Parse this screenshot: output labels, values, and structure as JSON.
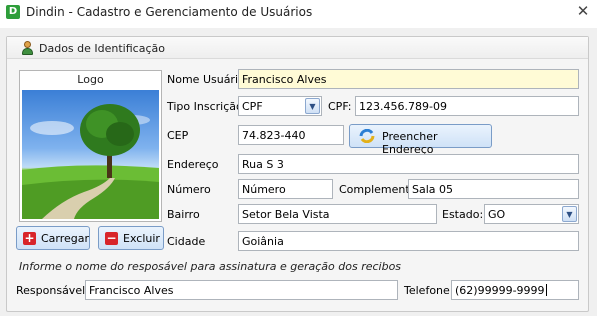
{
  "window": {
    "icon_letter": "D",
    "title": "Dindin - Cadastro e Gerenciamento de Usuários",
    "close_glyph": "✕"
  },
  "group": {
    "title": "Dados de Identificação"
  },
  "logo": {
    "label": "Logo",
    "load_button": "Carregar",
    "load_icon_glyph": "+",
    "delete_button": "Excluir",
    "delete_icon_glyph": "−"
  },
  "form": {
    "nome_label": "Nome Usuário",
    "nome_value": "Francisco Alves",
    "tipo_label": "Tipo Inscrição",
    "tipo_value": "CPF",
    "cpf_label": "CPF:",
    "cpf_value": "123.456.789-09",
    "cep_label": "CEP",
    "cep_value": "74.823-440",
    "fill_address_button": "Preencher Endereço",
    "endereco_label": "Endereço",
    "endereco_value": "Rua S 3",
    "numero_label": "Número",
    "numero_value": "Número",
    "complemento_label": "Complemento",
    "complemento_value": "Sala 05",
    "bairro_label": "Bairro",
    "bairro_value": "Setor Bela Vista",
    "estado_label": "Estado:",
    "estado_value": "GO",
    "cidade_label": "Cidade",
    "cidade_value": "Goiânia",
    "combo_arrow_glyph": "▼"
  },
  "responsible": {
    "instruction": "Informe o nome do resposável para assinatura e geração dos recibos",
    "responsavel_label": "Responsável:",
    "responsavel_value": "Francisco Alves",
    "telefone_label": "Telefone",
    "telefone_value": "(62)99999-9999"
  },
  "colors": {
    "accent_button_border": "#7a9cc7",
    "highlight_field": "#fffbd6",
    "delete_red": "#d8242a"
  }
}
